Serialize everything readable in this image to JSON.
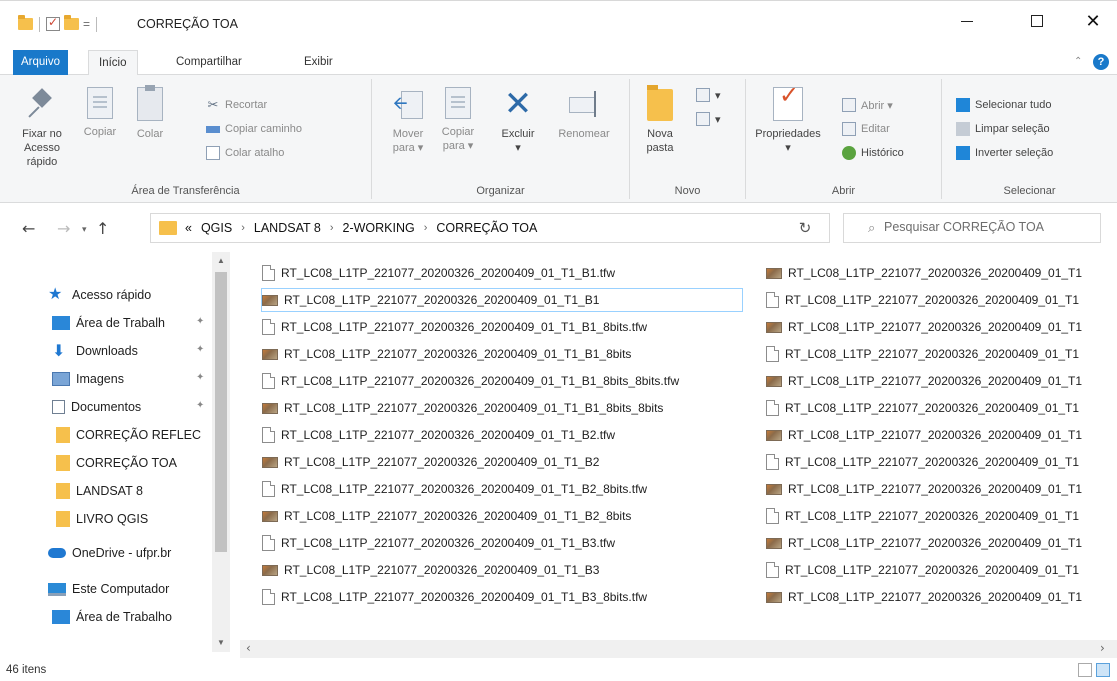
{
  "window": {
    "title": "CORREÇÃO TOA"
  },
  "ribbon_tabs": [
    "Arquivo",
    "Início",
    "Compartilhar",
    "Exibir"
  ],
  "ribbon": {
    "clipboard": {
      "pin_label_1": "Fixar no",
      "pin_label_2": "Acesso rápido",
      "copy": "Copiar",
      "paste": "Colar",
      "cut": "Recortar",
      "copy_path": "Copiar caminho",
      "paste_shortcut": "Colar atalho",
      "label": "Área de Transferência"
    },
    "organize": {
      "move_1": "Mover",
      "move_2": "para ▾",
      "copy_1": "Copiar",
      "copy_2": "para ▾",
      "delete": "Excluir",
      "delete_dd": "▾",
      "rename": "Renomear",
      "label": "Organizar"
    },
    "new": {
      "new_folder_1": "Nova",
      "new_folder_2": "pasta",
      "label": "Novo"
    },
    "open": {
      "properties": "Propriedades",
      "properties_dd": "▾",
      "open": "Abrir ▾",
      "edit": "Editar",
      "history": "Histórico",
      "label": "Abrir"
    },
    "select": {
      "select_all": "Selecionar tudo",
      "select_none": "Limpar seleção",
      "invert": "Inverter seleção",
      "label": "Selecionar"
    }
  },
  "address": {
    "crumbs": [
      "«",
      "QGIS",
      "LANDSAT 8",
      "2-WORKING",
      "CORREÇÃO TOA"
    ],
    "separator": "›",
    "search_placeholder": "Pesquisar CORREÇÃO TOA"
  },
  "nav_pane": {
    "items": [
      {
        "label": "Acesso rápido",
        "icon": "star-icon"
      },
      {
        "label": "Área de Trabalh",
        "icon": "desktop-icon",
        "pinned": true
      },
      {
        "label": "Downloads",
        "icon": "download-icon",
        "pinned": true
      },
      {
        "label": "Imagens",
        "icon": "pictures-icon",
        "pinned": true
      },
      {
        "label": "Documentos",
        "icon": "documents-icon",
        "pinned": true
      },
      {
        "label": "CORREÇÃO REFLEC",
        "icon": "folder-icon"
      },
      {
        "label": "CORREÇÃO TOA",
        "icon": "folder-icon"
      },
      {
        "label": "LANDSAT 8",
        "icon": "folder-icon"
      },
      {
        "label": "LIVRO QGIS",
        "icon": "folder-icon"
      },
      {
        "label": "OneDrive - ufpr.br",
        "icon": "onedrive-icon"
      },
      {
        "label": "Este Computador",
        "icon": "computer-icon"
      },
      {
        "label": "Área de Trabalho",
        "icon": "desktop-icon"
      }
    ]
  },
  "files_col1": [
    {
      "name": "RT_LC08_L1TP_221077_20200326_20200409_01_T1_B1.tfw",
      "type": "tfw"
    },
    {
      "name": "RT_LC08_L1TP_221077_20200326_20200409_01_T1_B1",
      "type": "image",
      "selected": true
    },
    {
      "name": "RT_LC08_L1TP_221077_20200326_20200409_01_T1_B1_8bits.tfw",
      "type": "tfw"
    },
    {
      "name": "RT_LC08_L1TP_221077_20200326_20200409_01_T1_B1_8bits",
      "type": "image"
    },
    {
      "name": "RT_LC08_L1TP_221077_20200326_20200409_01_T1_B1_8bits_8bits.tfw",
      "type": "tfw"
    },
    {
      "name": "RT_LC08_L1TP_221077_20200326_20200409_01_T1_B1_8bits_8bits",
      "type": "image"
    },
    {
      "name": "RT_LC08_L1TP_221077_20200326_20200409_01_T1_B2.tfw",
      "type": "tfw"
    },
    {
      "name": "RT_LC08_L1TP_221077_20200326_20200409_01_T1_B2",
      "type": "image"
    },
    {
      "name": "RT_LC08_L1TP_221077_20200326_20200409_01_T1_B2_8bits.tfw",
      "type": "tfw"
    },
    {
      "name": "RT_LC08_L1TP_221077_20200326_20200409_01_T1_B2_8bits",
      "type": "image"
    },
    {
      "name": "RT_LC08_L1TP_221077_20200326_20200409_01_T1_B3.tfw",
      "type": "tfw"
    },
    {
      "name": "RT_LC08_L1TP_221077_20200326_20200409_01_T1_B3",
      "type": "image"
    },
    {
      "name": "RT_LC08_L1TP_221077_20200326_20200409_01_T1_B3_8bits.tfw",
      "type": "tfw"
    }
  ],
  "files_col2": [
    {
      "name": "RT_LC08_L1TP_221077_20200326_20200409_01_T1",
      "type": "image"
    },
    {
      "name": "RT_LC08_L1TP_221077_20200326_20200409_01_T1",
      "type": "tfw"
    },
    {
      "name": "RT_LC08_L1TP_221077_20200326_20200409_01_T1",
      "type": "image"
    },
    {
      "name": "RT_LC08_L1TP_221077_20200326_20200409_01_T1",
      "type": "tfw"
    },
    {
      "name": "RT_LC08_L1TP_221077_20200326_20200409_01_T1",
      "type": "image"
    },
    {
      "name": "RT_LC08_L1TP_221077_20200326_20200409_01_T1",
      "type": "tfw"
    },
    {
      "name": "RT_LC08_L1TP_221077_20200326_20200409_01_T1",
      "type": "image"
    },
    {
      "name": "RT_LC08_L1TP_221077_20200326_20200409_01_T1",
      "type": "tfw"
    },
    {
      "name": "RT_LC08_L1TP_221077_20200326_20200409_01_T1",
      "type": "image"
    },
    {
      "name": "RT_LC08_L1TP_221077_20200326_20200409_01_T1",
      "type": "tfw"
    },
    {
      "name": "RT_LC08_L1TP_221077_20200326_20200409_01_T1",
      "type": "image"
    },
    {
      "name": "RT_LC08_L1TP_221077_20200326_20200409_01_T1",
      "type": "tfw"
    },
    {
      "name": "RT_LC08_L1TP_221077_20200326_20200409_01_T1",
      "type": "image"
    }
  ],
  "status": {
    "count": "46 itens"
  },
  "colors": {
    "accent": "#1979ca",
    "folder": "#f6c04c",
    "ribbon_bg": "#f5f6f7",
    "selection_border": "#99d1ff"
  }
}
